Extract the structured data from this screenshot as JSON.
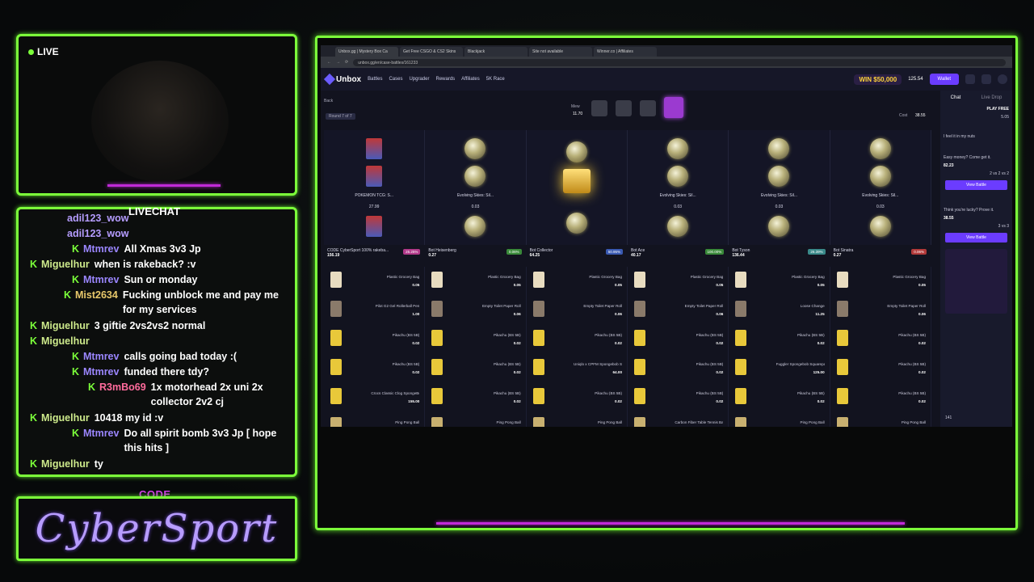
{
  "overlay": {
    "live_label": "LIVE",
    "chat_header": "LIVECHAT",
    "code_label": "CODE",
    "code_value": "CyberSport"
  },
  "chat": [
    {
      "user": "adil123_wow",
      "text": "",
      "color": "#b59cff",
      "indent": 0
    },
    {
      "user": "adil123_wow",
      "text": "",
      "color": "#b59cff",
      "indent": 0
    },
    {
      "user": "Mtmrev",
      "text": "All Xmas 3v3 Jp",
      "color": "#9b86ff",
      "indent": 2
    },
    {
      "user": "Miguelhur",
      "text": "when is rakeback? :v",
      "color": "#cde98b",
      "indent": 1
    },
    {
      "user": "Mtmrev",
      "text": "Sun or monday",
      "color": "#9b86ff",
      "indent": 2
    },
    {
      "user": "Mist2634",
      "text": "Fucking unblock me and pay me for my services",
      "color": "#e8c86b",
      "indent": 3
    },
    {
      "user": "Miguelhur",
      "text": "3 giftie 2vs2vs2 normal",
      "color": "#cde98b",
      "indent": 1
    },
    {
      "user": "Miguelhur",
      "text": "",
      "color": "#cde98b",
      "indent": 1
    },
    {
      "user": "Mtmrev",
      "text": "calls going bad today :(",
      "color": "#9b86ff",
      "indent": 2
    },
    {
      "user": "Mtmrev",
      "text": "funded there tdy?",
      "color": "#9b86ff",
      "indent": 2
    },
    {
      "user": "R3mBo69",
      "text": "1x motorhead 2x uni 2x collector 2v2 cj",
      "color": "#ff6b9c",
      "indent": 4
    },
    {
      "user": "Miguelhur",
      "text": "10418 my id :v",
      "color": "#cde98b",
      "indent": 1
    },
    {
      "user": "Mtmrev",
      "text": "Do all spirit bomb 3v3 Jp [ hope this hits ]",
      "color": "#9b86ff",
      "indent": 2
    },
    {
      "user": "Miguelhur",
      "text": "ty",
      "color": "#cde98b",
      "indent": 1
    }
  ],
  "browser": {
    "tabs": [
      "Unbox.gg | Mystery Box Ca",
      "Get Free CSGO & CS2 Skins",
      "Blackjack",
      "Site not available",
      "Winner.co | Affiliates"
    ],
    "url": "unbox.gg/en/case-battles/161233",
    "nav": [
      "Battles",
      "Cases",
      "Upgrader",
      "Rewards",
      "Affiliates",
      "5K Race"
    ],
    "logo": "Unbox",
    "win_badge": "WIN $50,000",
    "balance": "125.54",
    "wallet": "Wallet",
    "back": "Back",
    "round": "Round 7 of 7",
    "cost_label": "Cost",
    "cost": "38.55",
    "box_label": "Mew",
    "box_price": "11.70",
    "spins": [
      {
        "name": "POKEMON TCG: S...",
        "value": "27.99",
        "kind": "card"
      },
      {
        "name": "Evolving Skies: Sil...",
        "value": "0.03",
        "kind": "coin"
      },
      {
        "name": "",
        "value": "",
        "kind": "chest"
      },
      {
        "name": "Evolving Skies: Sil...",
        "value": "0.03",
        "kind": "coin"
      },
      {
        "name": "Evolving Skies: Sil...",
        "value": "0.03",
        "kind": "coin"
      },
      {
        "name": "Evolving Skies: Sil...",
        "value": "0.03",
        "kind": "coin"
      }
    ],
    "players": [
      {
        "name": "CODE CyberSport 100% rakeba...",
        "value": "156.19",
        "pct": "25.25%",
        "pcolor": "#b23a8a"
      },
      {
        "name": "Bot Heisenberg",
        "value": "0.27",
        "pct": "0.06%",
        "pcolor": "#3a8a3a"
      },
      {
        "name": "Bot Collector",
        "value": "64.25",
        "pct": "50.95%",
        "pcolor": "#3a5ab2"
      },
      {
        "name": "Bot Ace",
        "value": "40.17",
        "pct": "100.00%",
        "pcolor": "#3a8a3a"
      },
      {
        "name": "Bot Tyson",
        "value": "136.44",
        "pct": "26.39%",
        "pcolor": "#3a8a8a"
      },
      {
        "name": "Bot Sinatra",
        "value": "0.27",
        "pct": "0.06%",
        "pcolor": "#b23a3a"
      }
    ],
    "items": [
      [
        {
          "n": "Plastic Grocery Bag",
          "p": "0.05"
        },
        {
          "n": "Plastic Grocery Bag",
          "p": "0.05"
        },
        {
          "n": "Plastic Grocery Bag",
          "p": "0.05"
        },
        {
          "n": "Plastic Grocery Bag",
          "p": "0.05"
        },
        {
          "n": "Plastic Grocery Bag",
          "p": "0.05"
        },
        {
          "n": "Plastic Grocery Bag",
          "p": "0.05"
        }
      ],
      [
        {
          "n": "Pilot G2 Gel Rollerball Pen",
          "p": "1.00"
        },
        {
          "n": "Empty Toilet Paper Roll",
          "p": "0.06"
        },
        {
          "n": "Empty Toilet Paper Roll",
          "p": "0.06"
        },
        {
          "n": "Empty Toilet Paper Roll",
          "p": "0.06"
        },
        {
          "n": "Loose Change",
          "p": "11.25"
        },
        {
          "n": "Empty Toilet Paper Roll",
          "p": "0.06"
        }
      ],
      [
        {
          "n": "Pikachu (BS 5B)",
          "p": "0.02"
        },
        {
          "n": "Pikachu (BS 5B)",
          "p": "0.02"
        },
        {
          "n": "Pikachu (BS 5B)",
          "p": "0.02"
        },
        {
          "n": "Pikachu (BS 5B)",
          "p": "0.02"
        },
        {
          "n": "Pikachu (BS 5B)",
          "p": "0.02"
        },
        {
          "n": "Pikachu (BS 5B)",
          "p": "0.02"
        }
      ],
      [
        {
          "n": "Pikachu (BS 5B)",
          "p": "0.02"
        },
        {
          "n": "Pikachu (BS 5B)",
          "p": "0.02"
        },
        {
          "n": "Uniqlo x CPFM Spongebob Square...",
          "p": "64.00"
        },
        {
          "n": "Pikachu (BS 5B)",
          "p": "0.02"
        },
        {
          "n": "Fuggler Spongebob Squarepants ...",
          "p": "125.00"
        },
        {
          "n": "Pikachu (BS 5B)",
          "p": "0.02"
        }
      ],
      [
        {
          "n": "Crocs Classic Clog SpongeBob Sq...",
          "p": "155.00"
        },
        {
          "n": "Pikachu (BS 5B)",
          "p": "0.02"
        },
        {
          "n": "Pikachu (BS 5B)",
          "p": "0.02"
        },
        {
          "n": "Pikachu (BS 5B)",
          "p": "0.02"
        },
        {
          "n": "Pikachu (BS 5B)",
          "p": "0.02"
        },
        {
          "n": "Pikachu (BS 5B)",
          "p": "0.02"
        }
      ],
      [
        {
          "n": "Ping Pong Ball",
          "p": ""
        },
        {
          "n": "Ping Pong Ball",
          "p": ""
        },
        {
          "n": "Ping Pong Ball",
          "p": ""
        },
        {
          "n": "Carbon Fiber Table Tennis Bat Ca...",
          "p": ""
        },
        {
          "n": "Ping Pong Ball",
          "p": ""
        },
        {
          "n": "Ping Pong Ball",
          "p": ""
        }
      ]
    ],
    "side": {
      "tabs": [
        "Chat",
        "Live Drop"
      ],
      "play_free": "PLAY FREE",
      "play_val": "5.05",
      "msg1": "I feel it in my nuts",
      "msg2": "Easy money? Come get it.",
      "price1": "82.23",
      "team1": "2 vs 2 vs 2",
      "view": "View Battle",
      "msg3": "Think you're lucky? Prove it.",
      "price2": "38.55",
      "team2": "3 vs 3",
      "online": "141"
    }
  }
}
